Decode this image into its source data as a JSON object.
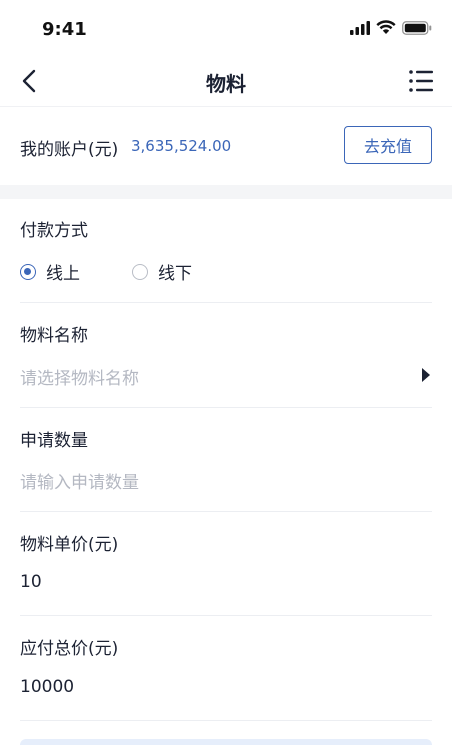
{
  "status_bar": {
    "time": "9:41"
  },
  "nav": {
    "title": "物料"
  },
  "account": {
    "label": "我的账户(元)",
    "balance": "3,635,524.00",
    "recharge_label": "去充值"
  },
  "payment": {
    "label": "付款方式",
    "options": [
      {
        "label": "线上",
        "selected": true
      },
      {
        "label": "线下",
        "selected": false
      }
    ]
  },
  "material_name": {
    "label": "物料名称",
    "placeholder": "请选择物料名称"
  },
  "quantity": {
    "label": "申请数量",
    "placeholder": "请输入申请数量"
  },
  "unit_price": {
    "label": "物料单价(元)",
    "value": "10"
  },
  "total_price": {
    "label": "应付总价(元)",
    "value": "10000"
  },
  "colors": {
    "accent": "#3b66b8",
    "placeholder": "#b4b8c2",
    "text": "#1c2233"
  }
}
